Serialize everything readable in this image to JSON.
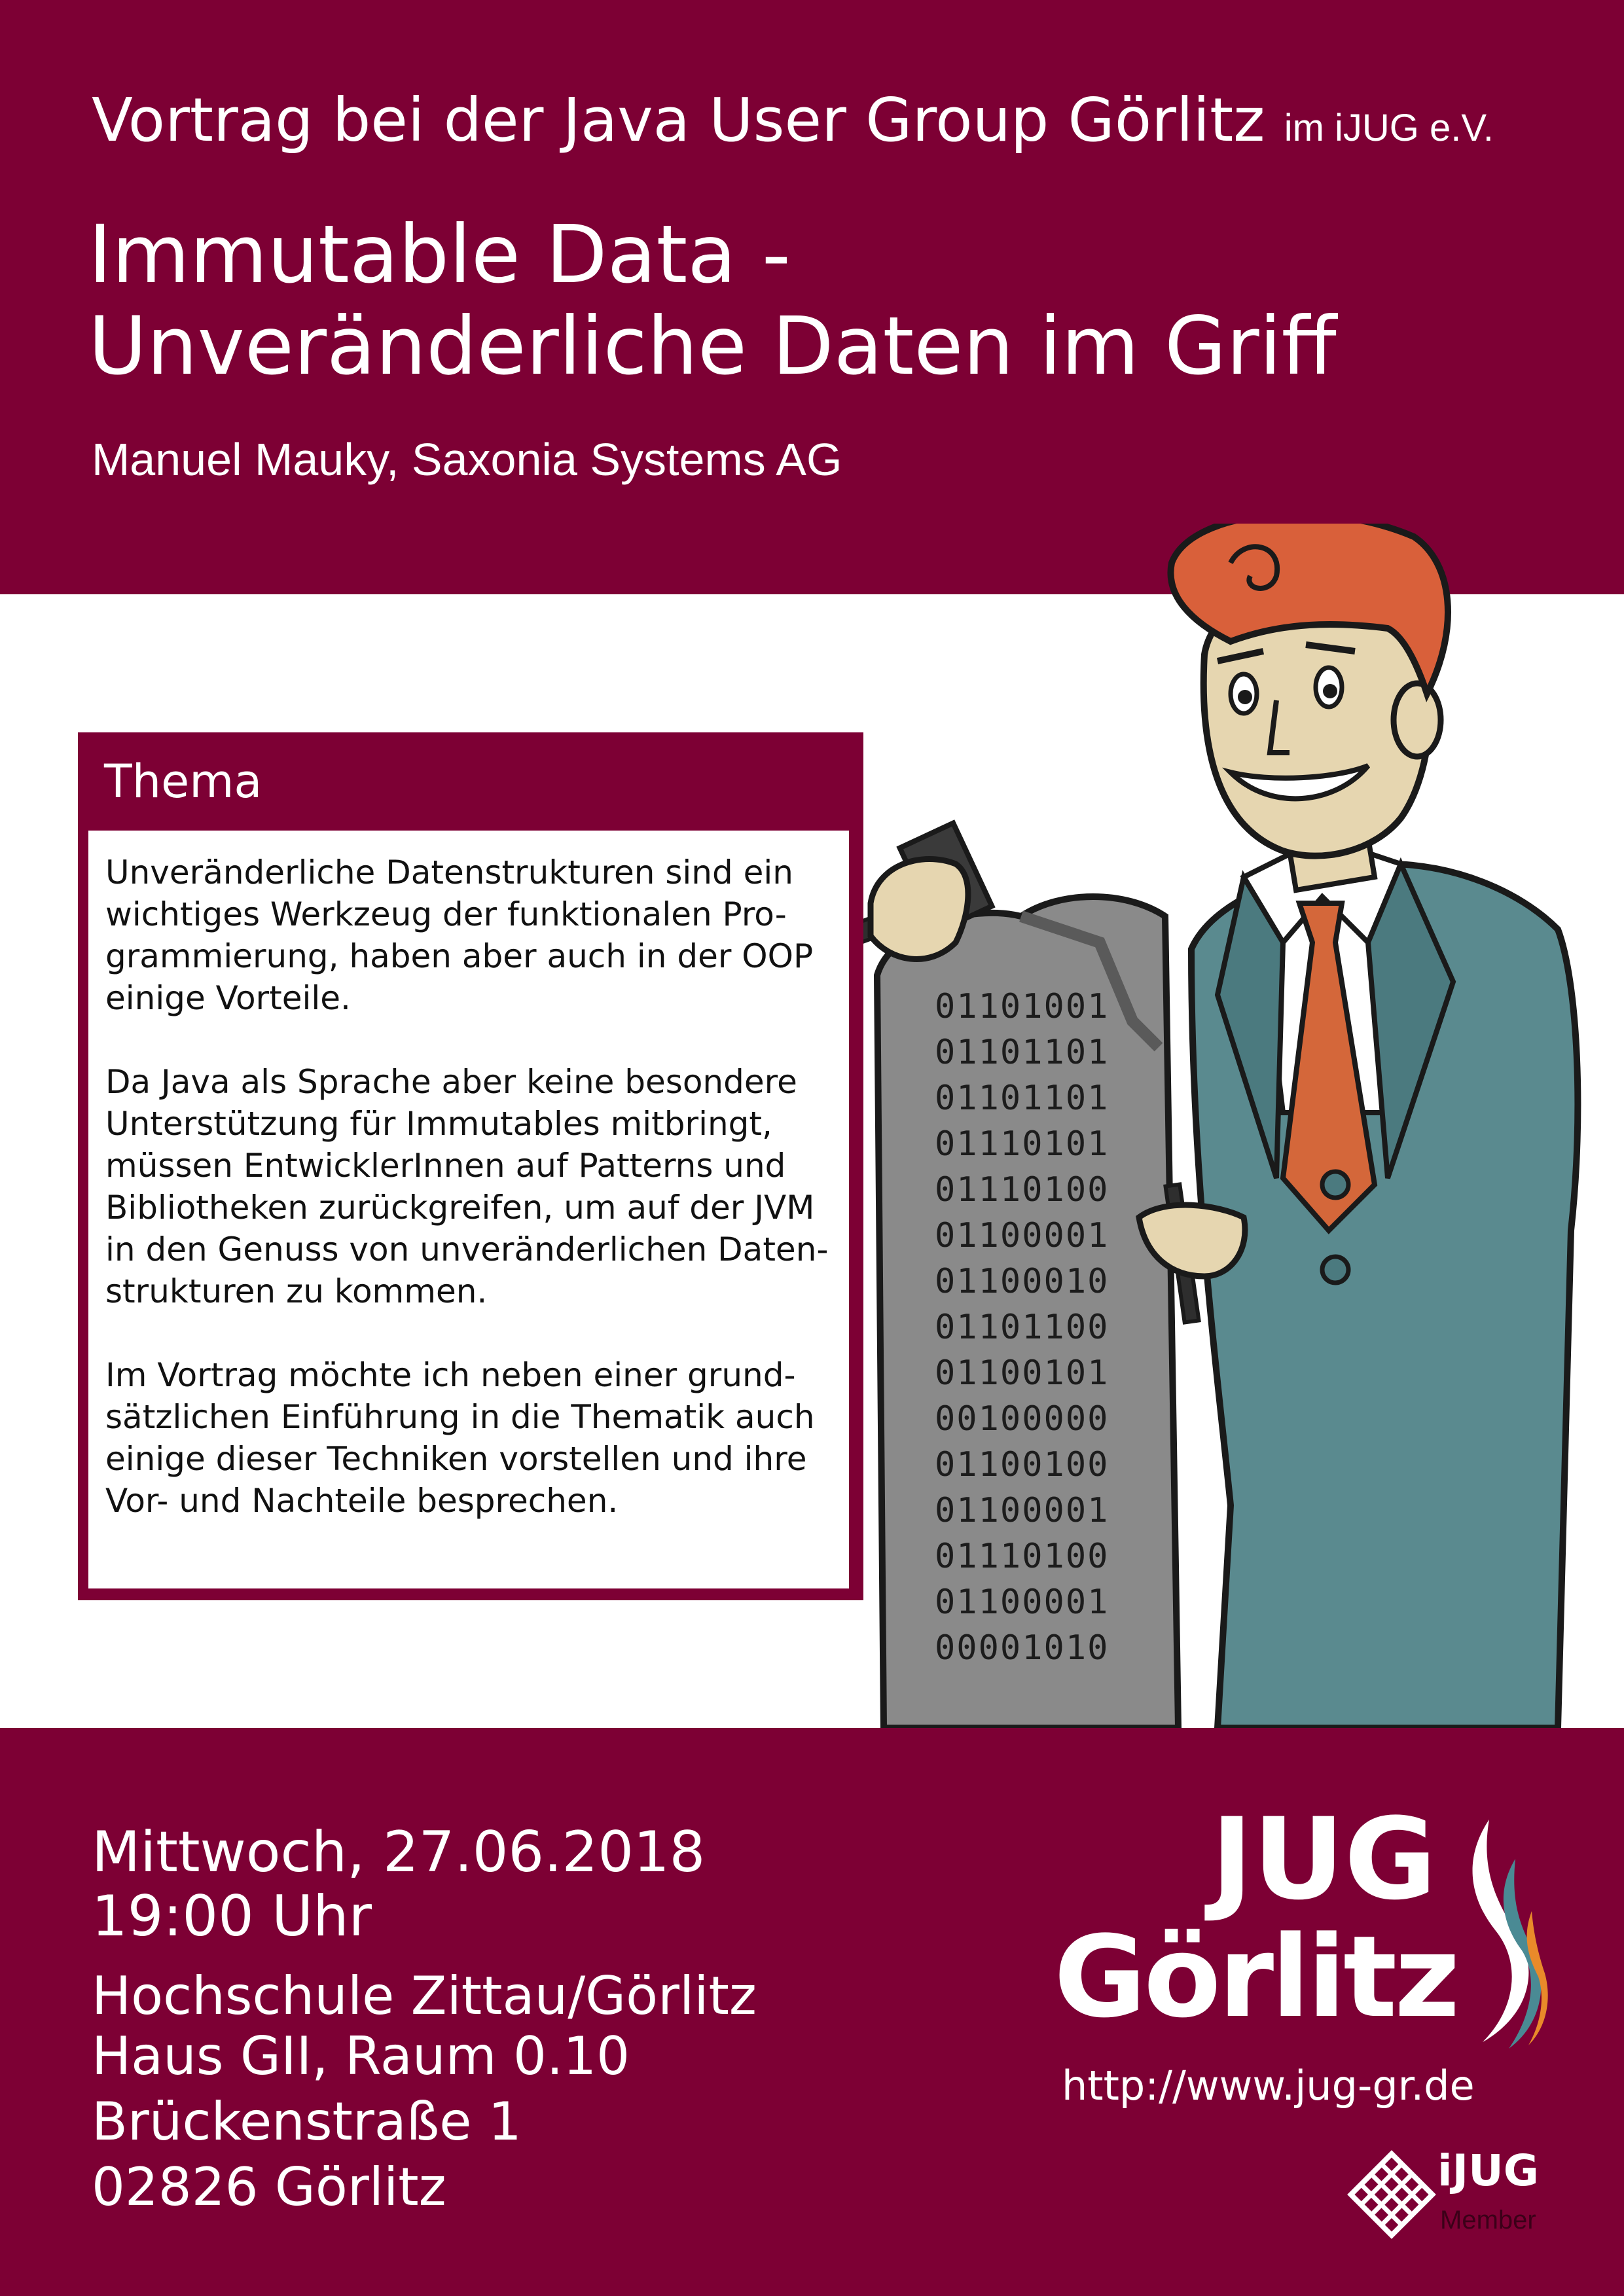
{
  "header": {
    "event_main": "Vortrag bei der Java User Group Görlitz",
    "event_suffix": "im iJUG e.V.",
    "title_line1": "Immutable Data -",
    "title_line2": "Unveränderliche Daten im Griff",
    "speaker": "Manuel Mauky, Saxonia Systems AG"
  },
  "topic": {
    "heading": "Thema",
    "paragraph1": [
      "Unveränderliche Datenstrukturen sind ein",
      "wichtiges Werkzeug der funktionalen Pro-",
      "grammierung, haben aber auch in der OOP",
      "einige Vorteile."
    ],
    "paragraph2": [
      "Da Java als Sprache aber keine besondere",
      "Unterstützung für Immutables mitbringt,",
      "müssen EntwicklerInnen auf Patterns und",
      "Bibliotheken zurückgreifen, um auf der JVM",
      "in den Genuss von unveränderlichen Daten-",
      "strukturen zu kommen."
    ],
    "paragraph3": [
      "Im Vortrag möchte ich neben einer grund-",
      "sätzlichen Einführung in die Thematik auch",
      "einige dieser Techniken vorstellen und ihre",
      "Vor- und Nachteile besprechen."
    ]
  },
  "binary_tablet": [
    "01101001",
    "01101101",
    "01101101",
    "01110101",
    "01110100",
    "01100001",
    "01100010",
    "01101100",
    "01100101",
    "00100000",
    "01100100",
    "01100001",
    "01110100",
    "01100001",
    "00001010"
  ],
  "footer": {
    "date": "Mittwoch, 27.06.2018",
    "time": "19:00 Uhr",
    "venue_line1": "Hochschule Zittau/Görlitz",
    "venue_line2": "Haus GII, Raum 0.10",
    "venue_line3": "Brückenstraße 1",
    "venue_line4": "02826 Görlitz"
  },
  "logo": {
    "line1": "JUG",
    "line2": "Görlitz",
    "url": "http://www.jug-gr.de",
    "ijug": "iJUG",
    "member": "Member"
  },
  "colors": {
    "band": "#7d0034",
    "hair": "#d9603a",
    "suit": "#5a8a8f",
    "tie": "#d4673a",
    "tablet": "#8a8a8a",
    "skin": "#e6d6b0"
  }
}
